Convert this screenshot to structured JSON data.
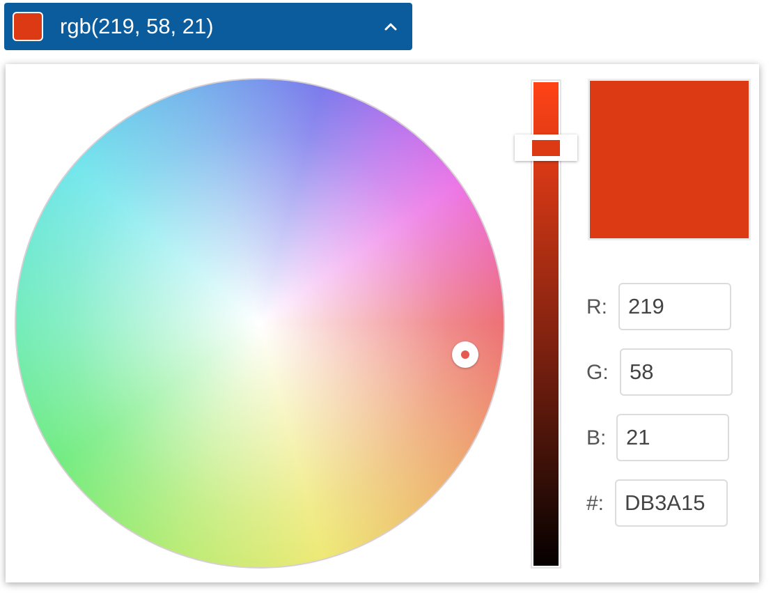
{
  "header": {
    "label": "rgb(219, 58, 21)",
    "background_color": "#0a5c9c",
    "swatch_color": "#db3a15",
    "toggle_icon": "chevron-up-icon"
  },
  "picker": {
    "selected_color": "#db3a15",
    "wheel_handle_color": "#e55a4e",
    "value_level": 0.86,
    "fields": [
      {
        "label": "R:",
        "value": "219"
      },
      {
        "label": "G:",
        "value": "58"
      },
      {
        "label": "B:",
        "value": "21"
      },
      {
        "label": "#:",
        "value": "DB3A15"
      }
    ]
  }
}
